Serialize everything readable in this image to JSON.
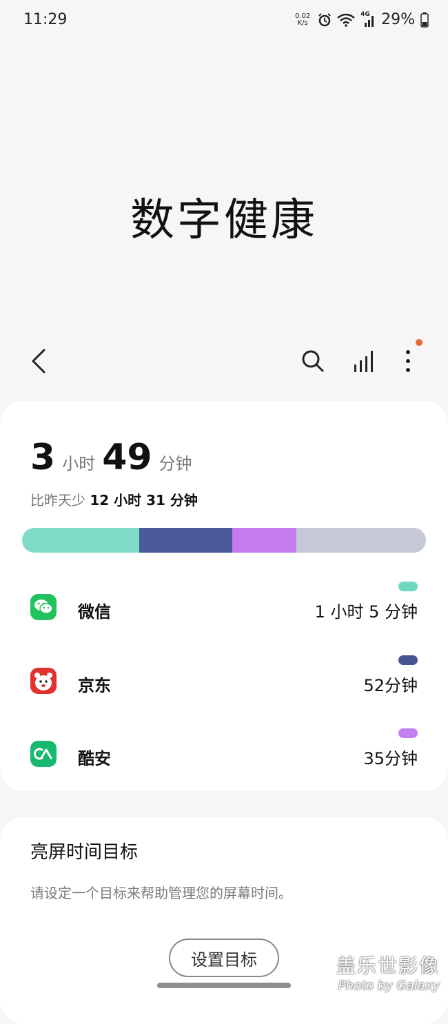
{
  "status": {
    "time": "11:29",
    "speed_top": "0.02",
    "speed_bottom": "K/s",
    "network": "4G",
    "battery": "29%"
  },
  "hero": {
    "title": "数字健康"
  },
  "summary": {
    "hours": "3",
    "hours_unit": "小时",
    "minutes": "49",
    "minutes_unit": "分钟",
    "compare_prefix": "比昨天少",
    "compare_value": "12 小时 31 分钟"
  },
  "usage_bar": {
    "segments": [
      {
        "app": "微信",
        "fraction": 0.29,
        "color": "#7fdcc7"
      },
      {
        "app": "京东",
        "fraction": 0.23,
        "color": "#4b5a99"
      },
      {
        "app": "酷安",
        "fraction": 0.16,
        "color": "#c57af0"
      },
      {
        "app": "other",
        "fraction": 0.32,
        "color": "#c5c8d7"
      }
    ]
  },
  "apps": [
    {
      "name": "微信",
      "time": "1 小时 5 分钟",
      "color": "#6fd6c2",
      "icon": "wechat-icon"
    },
    {
      "name": "京东",
      "time": "52分钟",
      "color": "#45548f",
      "icon": "jd-icon"
    },
    {
      "name": "酷安",
      "time": "35分钟",
      "color": "#c47ff2",
      "icon": "coolapk-icon"
    }
  ],
  "goal": {
    "title": "亮屏时间目标",
    "description": "请设定一个目标来帮助管理您的屏幕时间。",
    "button": "设置目标"
  },
  "watermark": {
    "line1": "盖乐世影像",
    "line2": "Photo by Galaxy"
  }
}
